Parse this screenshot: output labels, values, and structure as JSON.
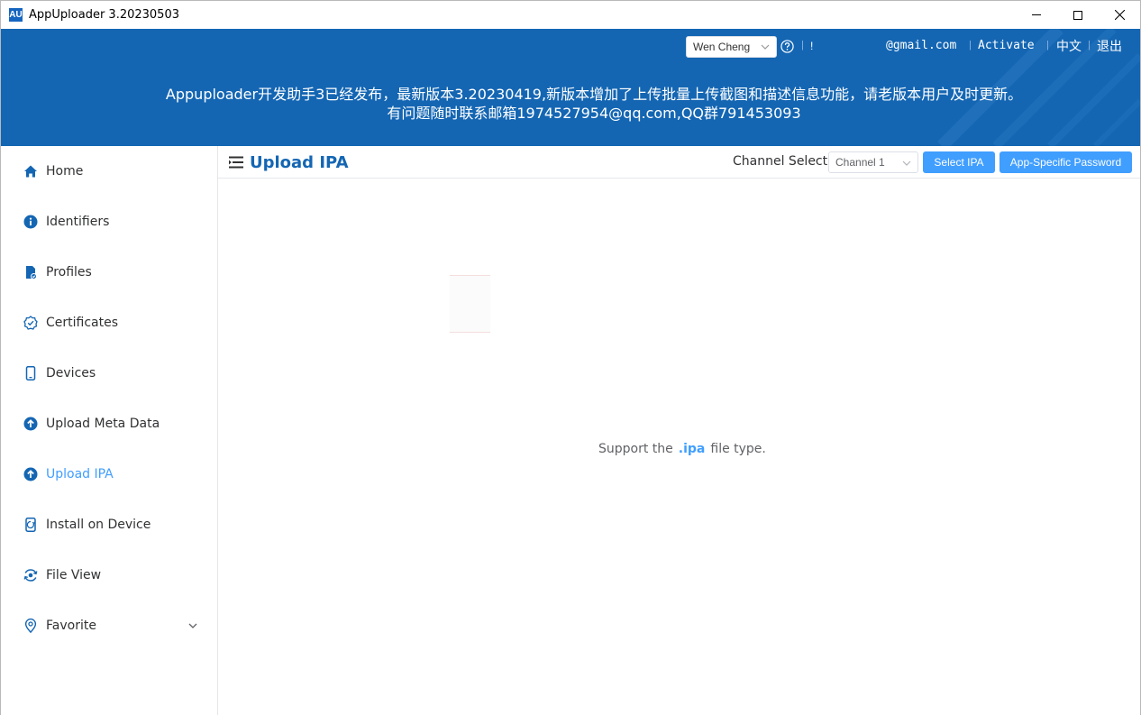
{
  "window": {
    "title": "AppUploader 3.20230503",
    "logo_text": "AU"
  },
  "header": {
    "user": "Wen Cheng",
    "bang": "!",
    "email": "@gmail.com",
    "activate": "Activate",
    "language": "中文",
    "logout": "退出",
    "notice_line1": "Appuploader开发助手3已经发布，最新版本3.20230419,新版本增加了上传批量上传截图和描述信息功能，请老版本用户及时更新。",
    "notice_line2": "有问题随时联系邮箱1974527954@qq.com,QQ群791453093",
    "accent_color": "#1466b3"
  },
  "sidebar": {
    "items": [
      {
        "label": "Home",
        "icon": "home-icon"
      },
      {
        "label": "Identifiers",
        "icon": "info-icon"
      },
      {
        "label": "Profiles",
        "icon": "profile-icon"
      },
      {
        "label": "Certificates",
        "icon": "certificate-icon"
      },
      {
        "label": "Devices",
        "icon": "phone-icon"
      },
      {
        "label": "Upload Meta Data",
        "icon": "upload-icon"
      },
      {
        "label": "Upload IPA",
        "icon": "upload-icon",
        "active": true
      },
      {
        "label": "Install on Device",
        "icon": "install-icon"
      },
      {
        "label": "File View",
        "icon": "file-view-icon"
      },
      {
        "label": "Favorite",
        "icon": "location-icon"
      }
    ],
    "active_color": "#409eff"
  },
  "main": {
    "title": "Upload IPA",
    "channel_label": "Channel Select:",
    "channel_value": "Channel 1",
    "select_ipa": "Select IPA",
    "app_password": "App-Specific Password",
    "support_prefix": "Support the",
    "support_ext": ".ipa",
    "support_suffix": "file type."
  }
}
